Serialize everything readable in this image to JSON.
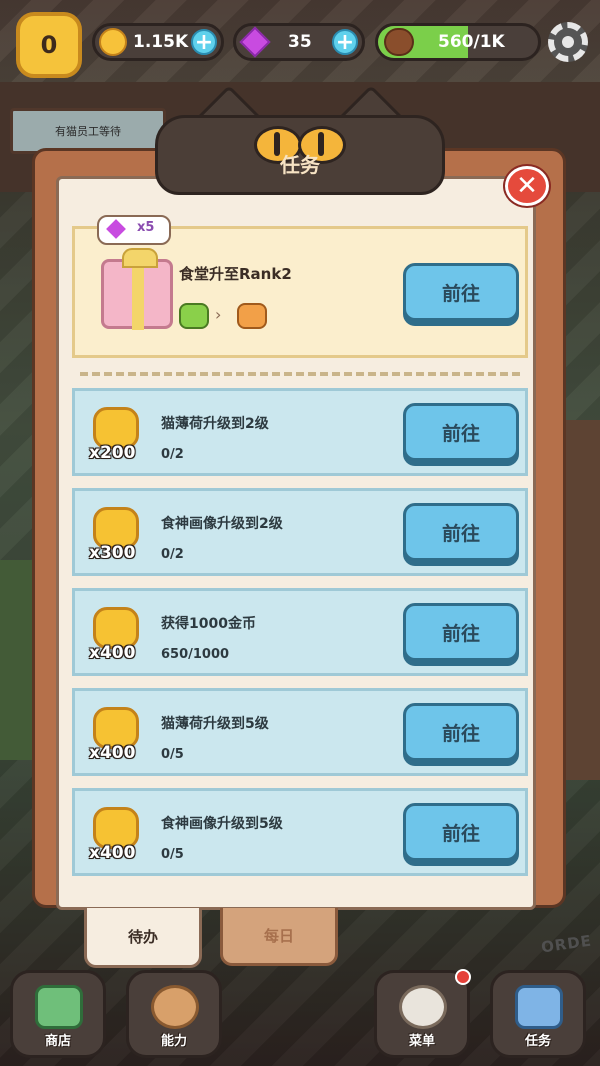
{
  "hud": {
    "level": "0",
    "coins": "1.15K",
    "gems": "35",
    "beans": "560/1K",
    "beans_fill_fraction": 0.56
  },
  "background": {
    "sign_text": "有猫员工等待",
    "floor_text": "ORDE"
  },
  "modal": {
    "title": "任务",
    "featured": {
      "reward_label": "x5",
      "name": "食堂升至Rank2",
      "button": "前往"
    },
    "tasks": [
      {
        "reward": "x200",
        "name": "猫薄荷升级到2级",
        "progress": "0/2",
        "button": "前往"
      },
      {
        "reward": "x300",
        "name": "食神画像升级到2级",
        "progress": "0/2",
        "button": "前往"
      },
      {
        "reward": "x400",
        "name": "获得1000金币",
        "progress": "650/1000",
        "button": "前往"
      },
      {
        "reward": "x400",
        "name": "猫薄荷升级到5级",
        "progress": "0/5",
        "button": "前往"
      },
      {
        "reward": "x400",
        "name": "食神画像升级到5级",
        "progress": "0/5",
        "button": "前往"
      }
    ],
    "tabs": {
      "todo": "待办",
      "daily": "每日"
    }
  },
  "nav": {
    "shop": "商店",
    "ability": "能力",
    "menu": "菜单",
    "tasks": "任务"
  },
  "colors": {
    "button": "#6ec5ea",
    "task_row": "#cbe7ee",
    "featured_row": "#fbeecd",
    "modal_frame": "#b5704a",
    "close": "#e54a3c"
  }
}
